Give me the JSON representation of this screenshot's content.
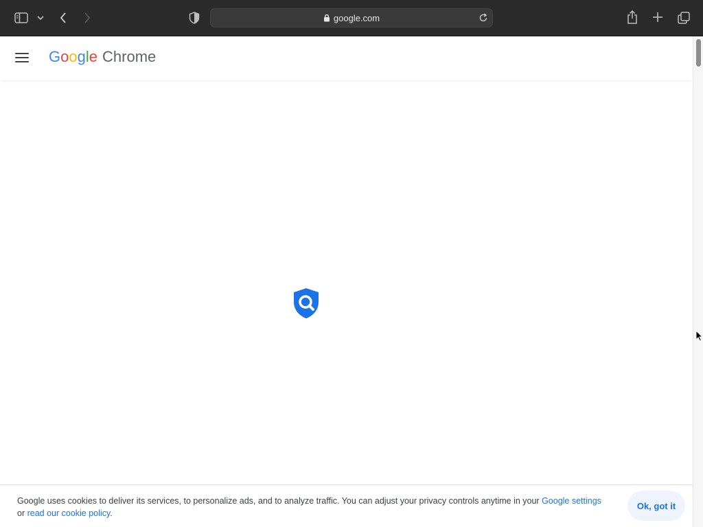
{
  "browser": {
    "url": "google.com",
    "icons": {
      "sidebar": "sidebar-icon",
      "sidebar_menu": "chevron-down-icon",
      "back": "chevron-left-icon",
      "forward": "chevron-right-icon",
      "privacy": "shield-half-icon",
      "lock": "lock-icon",
      "reload": "reload-icon",
      "share": "share-icon",
      "new_tab": "plus-icon",
      "tabs": "tabs-overview-icon"
    }
  },
  "header": {
    "logo_letters": [
      "G",
      "o",
      "o",
      "g",
      "l",
      "e"
    ],
    "product_name": "Chrome",
    "menu_icon": "hamburger-icon"
  },
  "main": {
    "center_icon": "shield-search-icon",
    "accent_color": "#1a73e8"
  },
  "cookie_banner": {
    "text_before_link": "Google uses cookies to deliver its services, to personalize ads, and to analyze traffic. You can adjust your privacy controls anytime in your ",
    "settings_link": "Google settings",
    "text_middle": "or ",
    "policy_link": "read our cookie policy",
    "text_end": ".",
    "ok_button": "Ok, got it"
  }
}
